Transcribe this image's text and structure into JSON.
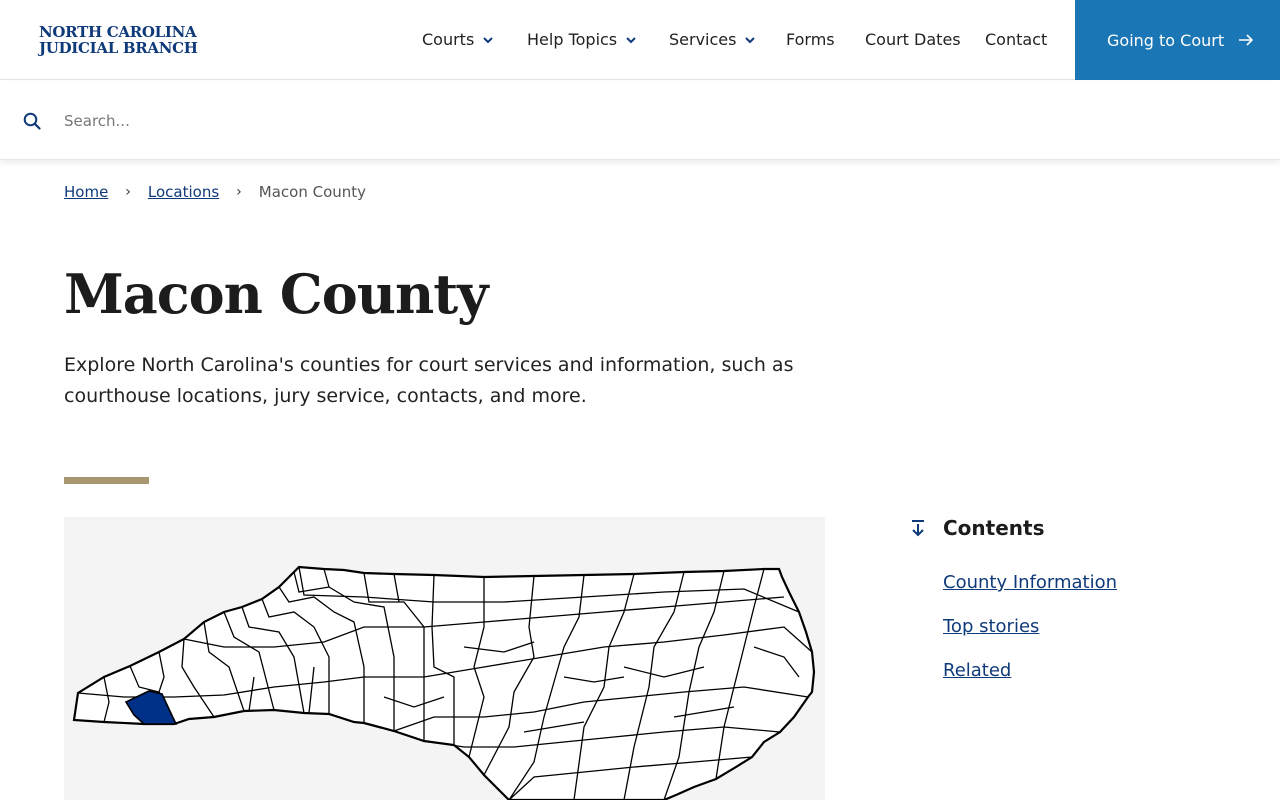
{
  "site": {
    "logo_line1": "NORTH CAROLINA",
    "logo_line2": "JUDICIAL BRANCH"
  },
  "nav": {
    "items": [
      {
        "label": "Courts",
        "dropdown": true
      },
      {
        "label": "Help Topics",
        "dropdown": true
      },
      {
        "label": "Services",
        "dropdown": true
      },
      {
        "label": "Forms",
        "dropdown": false
      },
      {
        "label": "Court Dates",
        "dropdown": false
      },
      {
        "label": "Contact",
        "dropdown": false
      }
    ],
    "cta_label": "Going to Court"
  },
  "search": {
    "placeholder": "Search..."
  },
  "breadcrumb": {
    "home": "Home",
    "locations": "Locations",
    "current": "Macon County"
  },
  "page": {
    "title": "Macon County",
    "intro": "Explore North Carolina's counties for court services and information, such as courthouse locations, jury service, contacts, and more."
  },
  "contents": {
    "heading": "Contents",
    "links": [
      "County Information",
      "Top stories",
      "Related"
    ]
  },
  "colors": {
    "brand": "#0f3a7a",
    "cta": "#1a76b4",
    "accent": "#a8976e",
    "highlight_county": "#003087"
  },
  "icons": {
    "search": "search-icon",
    "chevron": "chevron-down-icon",
    "cta_arrow": "arrow-right-icon",
    "contents": "arrow-down-to-line-icon"
  }
}
